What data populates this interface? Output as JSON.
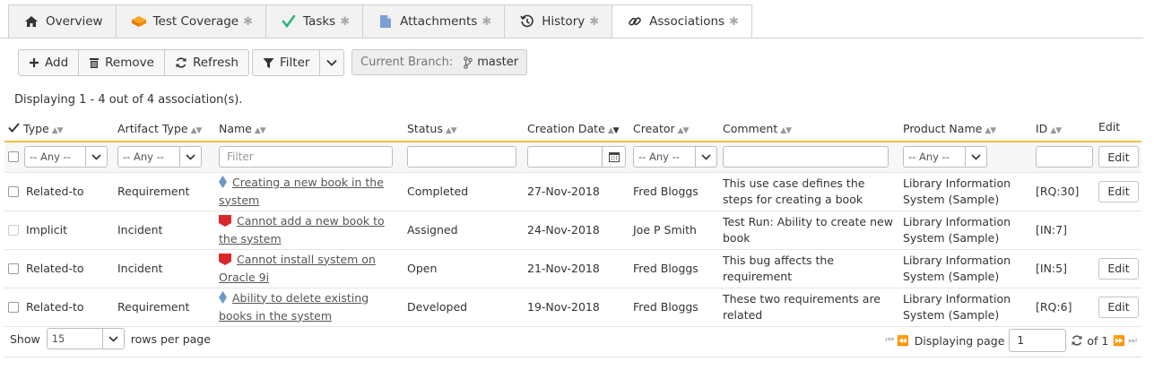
{
  "tabs": [
    {
      "label": "Overview",
      "icon": "home-icon",
      "star": ""
    },
    {
      "label": "Test Coverage",
      "icon": "test-coverage-icon",
      "star": "✱"
    },
    {
      "label": "Tasks",
      "icon": "check-icon",
      "star": "✱"
    },
    {
      "label": "Attachments",
      "icon": "document-icon",
      "star": "✱"
    },
    {
      "label": "History",
      "icon": "history-icon",
      "star": "✱"
    },
    {
      "label": "Associations",
      "icon": "link-icon",
      "star": "✱"
    }
  ],
  "toolbar": {
    "add": "Add",
    "remove": "Remove",
    "refresh": "Refresh",
    "filter": "Filter",
    "branch_label": "Current Branch:",
    "branch_value": "master"
  },
  "summary": {
    "prefix": "Displaying ",
    "range": "1 - 4",
    "middle": " out of ",
    "total": "4",
    "suffix": " association(s)."
  },
  "columns": {
    "type": "Type",
    "artifact_type": "Artifact Type",
    "name": "Name",
    "status": "Status",
    "creation_date": "Creation Date",
    "creator": "Creator",
    "comment": "Comment",
    "product": "Product Name",
    "id": "ID",
    "edit": "Edit"
  },
  "filters": {
    "type": "-- Any --",
    "artifact_type": "-- Any --",
    "name_placeholder": "Filter",
    "creator": "-- Any --",
    "product": "-- Any --",
    "edit": "Edit"
  },
  "rows": [
    {
      "type": "Related-to",
      "artifact_type": "Requirement",
      "name": "Creating a new book in the system",
      "name_icon": "requirement-icon",
      "status": "Completed",
      "date": "27-Nov-2018",
      "creator": "Fred Bloggs",
      "comment": "This use case defines the steps for creating a book",
      "product": "Library Information System (Sample)",
      "id": "[RQ:30]",
      "edit": "Edit",
      "checkbox_enabled": true
    },
    {
      "type": "Implicit",
      "artifact_type": "Incident",
      "name": "Cannot add a new book to the system",
      "name_icon": "incident-icon",
      "status": "Assigned",
      "date": "24-Nov-2018",
      "creator": "Joe P Smith",
      "comment": "Test Run: Ability to create new book",
      "product": "Library Information System (Sample)",
      "id": "[IN:7]",
      "edit": "",
      "checkbox_enabled": false
    },
    {
      "type": "Related-to",
      "artifact_type": "Incident",
      "name": "Cannot install system on Oracle 9i",
      "name_icon": "incident-icon",
      "status": "Open",
      "date": "21-Nov-2018",
      "creator": "Fred Bloggs",
      "comment": "This bug affects the requirement",
      "product": "Library Information System (Sample)",
      "id": "[IN:5]",
      "edit": "Edit",
      "checkbox_enabled": true
    },
    {
      "type": "Related-to",
      "artifact_type": "Requirement",
      "name": "Ability to delete existing books in the system",
      "name_icon": "requirement-icon",
      "status": "Developed",
      "date": "19-Nov-2018",
      "creator": "Fred Bloggs",
      "comment": "These two requirements are related",
      "product": "Library Information System (Sample)",
      "id": "[RQ:6]",
      "edit": "Edit",
      "checkbox_enabled": true
    }
  ],
  "footer": {
    "show_label": "Show",
    "rows_value": "15",
    "rows_label": "rows per page",
    "displaying_page": "Displaying page",
    "page_value": "1",
    "of_label": "of 1"
  },
  "colors": {
    "header_underline": "#f0c040",
    "incident_red": "#d9272e",
    "requirement_blue": "#6d97c9",
    "check_green": "#2bb573"
  }
}
